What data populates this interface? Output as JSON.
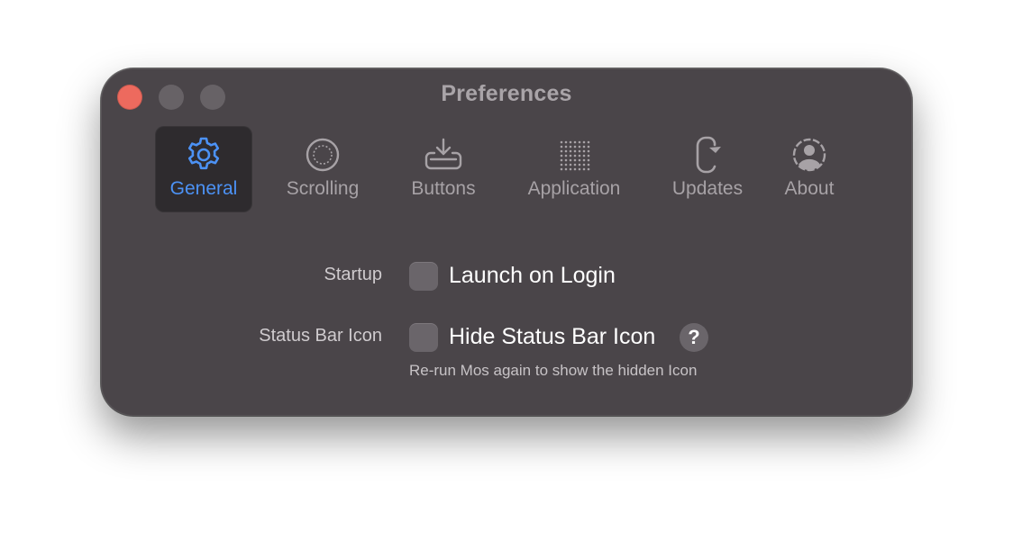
{
  "window": {
    "title": "Preferences"
  },
  "tabs": [
    {
      "label": "General",
      "icon": "gear-icon",
      "selected": true
    },
    {
      "label": "Scrolling",
      "icon": "scroll-circle-icon",
      "selected": false
    },
    {
      "label": "Buttons",
      "icon": "tray-download-icon",
      "selected": false
    },
    {
      "label": "Application",
      "icon": "dot-grid-icon",
      "selected": false
    },
    {
      "label": "Updates",
      "icon": "refresh-icon",
      "selected": false
    },
    {
      "label": "About",
      "icon": "person-circle-icon",
      "selected": false
    }
  ],
  "settings": {
    "startup": {
      "label": "Startup",
      "checkbox_label": "Launch on Login",
      "checked": false
    },
    "status_bar_icon": {
      "label": "Status Bar Icon",
      "checkbox_label": "Hide Status Bar Icon",
      "checked": false,
      "help_label": "?",
      "hint": "Re-run Mos again to show the hidden Icon"
    }
  },
  "colors": {
    "window_bg": "#4a4549",
    "selected_tab_bg": "#2e2b2e",
    "accent": "#4c92f5",
    "close_button": "#ed6a5e",
    "inactive_button": "#676266"
  }
}
